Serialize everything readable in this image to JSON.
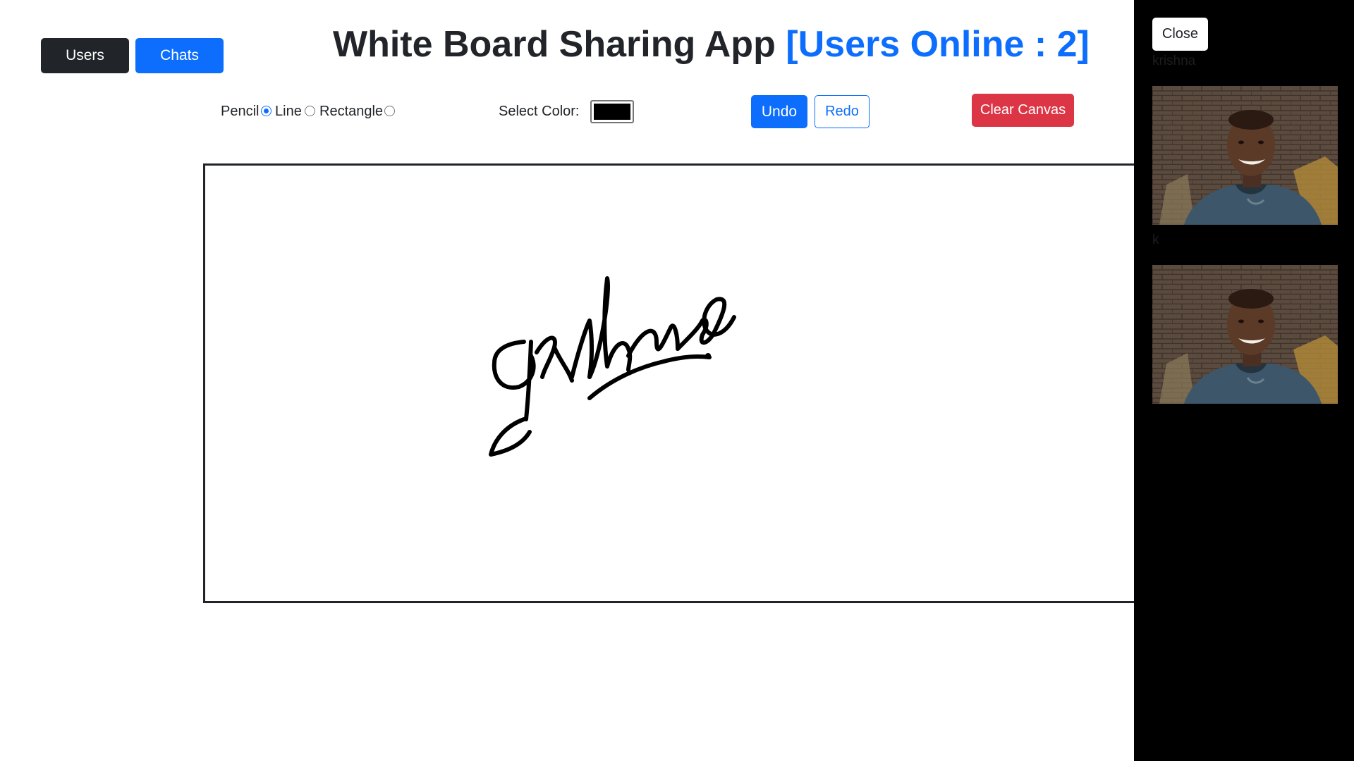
{
  "header": {
    "users_label": "Users",
    "chats_label": "Chats",
    "title": "White Board Sharing App",
    "online_text": "[Users Online : 2]"
  },
  "toolbar": {
    "tools": [
      {
        "label": "Pencil",
        "selected": true
      },
      {
        "label": "Line",
        "selected": false
      },
      {
        "label": "Rectangle",
        "selected": false
      }
    ],
    "color_label": "Select Color:",
    "selected_color": "#000000",
    "undo_label": "Undo",
    "redo_label": "Redo",
    "clear_label": "Clear Canvas"
  },
  "side_panel": {
    "close_label": "Close",
    "videos": [
      {
        "label": "krishna"
      },
      {
        "label": "k"
      }
    ]
  },
  "colors": {
    "primary": "#0d6efd",
    "dark": "#212529",
    "danger": "#dc3545",
    "panel_bg": "#000000"
  }
}
